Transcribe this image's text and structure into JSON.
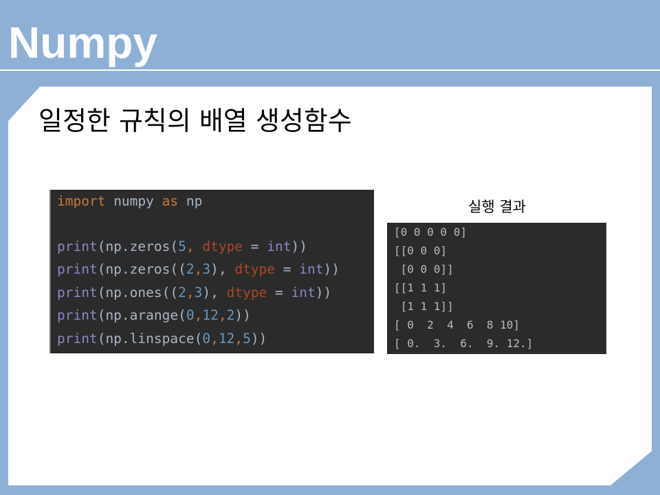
{
  "slide": {
    "title": "Numpy",
    "subtitle": "일정한 규칙의 배열 생성함수",
    "result_label": "실행 결과"
  },
  "code": {
    "lines": [
      [
        {
          "t": "import",
          "c": "kw"
        },
        {
          "t": " numpy ",
          "c": "tx"
        },
        {
          "t": "as",
          "c": "kw"
        },
        {
          "t": " np",
          "c": "tx"
        }
      ],
      [],
      [
        {
          "t": "print",
          "c": "fn"
        },
        {
          "t": "(np.zeros(",
          "c": "tx"
        },
        {
          "t": "5",
          "c": "num"
        },
        {
          "t": ", ",
          "c": "kw"
        },
        {
          "t": "dtype",
          "c": "prm"
        },
        {
          "t": " = ",
          "c": "tx"
        },
        {
          "t": "int",
          "c": "fn"
        },
        {
          "t": "))",
          "c": "tx"
        }
      ],
      [
        {
          "t": "print",
          "c": "fn"
        },
        {
          "t": "(np.zeros((",
          "c": "tx"
        },
        {
          "t": "2",
          "c": "num"
        },
        {
          "t": ",",
          "c": "kw"
        },
        {
          "t": "3",
          "c": "num"
        },
        {
          "t": "), ",
          "c": "tx"
        },
        {
          "t": "dtype",
          "c": "prm"
        },
        {
          "t": " = ",
          "c": "tx"
        },
        {
          "t": "int",
          "c": "fn"
        },
        {
          "t": "))",
          "c": "tx"
        }
      ],
      [
        {
          "t": "print",
          "c": "fn"
        },
        {
          "t": "(np.ones((",
          "c": "tx"
        },
        {
          "t": "2",
          "c": "num"
        },
        {
          "t": ",",
          "c": "kw"
        },
        {
          "t": "3",
          "c": "num"
        },
        {
          "t": "), ",
          "c": "tx"
        },
        {
          "t": "dtype",
          "c": "prm"
        },
        {
          "t": " = ",
          "c": "tx"
        },
        {
          "t": "int",
          "c": "fn"
        },
        {
          "t": "))",
          "c": "tx"
        }
      ],
      [
        {
          "t": "print",
          "c": "fn"
        },
        {
          "t": "(np.arange(",
          "c": "tx"
        },
        {
          "t": "0",
          "c": "num"
        },
        {
          "t": ",",
          "c": "kw"
        },
        {
          "t": "12",
          "c": "num"
        },
        {
          "t": ",",
          "c": "kw"
        },
        {
          "t": "2",
          "c": "num"
        },
        {
          "t": "))",
          "c": "tx"
        }
      ],
      [
        {
          "t": "print",
          "c": "fn"
        },
        {
          "t": "(np.linspace(",
          "c": "tx"
        },
        {
          "t": "0",
          "c": "num"
        },
        {
          "t": ",",
          "c": "kw"
        },
        {
          "t": "12",
          "c": "num"
        },
        {
          "t": ",",
          "c": "kw"
        },
        {
          "t": "5",
          "c": "num"
        },
        {
          "t": "))",
          "c": "tx"
        }
      ]
    ]
  },
  "output": {
    "lines": [
      "[0 0 0 0 0]",
      "[[0 0 0]",
      " [0 0 0]]",
      "[[1 1 1]",
      " [1 1 1]]",
      "[ 0  2  4  6  8 10]",
      "[ 0.  3.  6.  9. 12.]"
    ]
  },
  "colors": {
    "background": "#8fb0d5",
    "panel": "#ffffff",
    "code_bg": "#2b2b2b",
    "keyword": "#cc7832",
    "builtin": "#8888c6",
    "number": "#6897bb",
    "param": "#aa4926",
    "text": "#a9b7c6",
    "output_text": "#bbbbbb"
  }
}
